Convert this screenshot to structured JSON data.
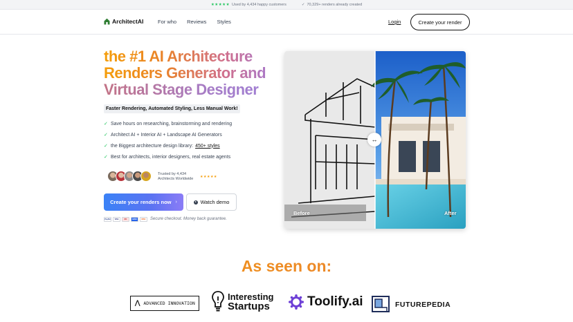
{
  "topbar": {
    "stars": "★★★★★",
    "customers": "Used by 4,434 happy customers",
    "check": "✓",
    "renders": "70,329+ renders already created"
  },
  "nav": {
    "brand": "ArchitectAI",
    "links": [
      "For who",
      "Reviews",
      "Styles"
    ],
    "login": "Login",
    "cta": "Create your render"
  },
  "hero": {
    "title_lines": [
      "the #1 AI Architecture",
      "Renders Generator and",
      "Virtual Stage Designer"
    ],
    "subtitle": "Faster Rendering, Automated Styling, Less Manual Work!",
    "benefits": [
      "Save hours on researching, brainstorming and rendering",
      "Architect AI + Interior AI + Landscape AI Generators",
      "the Biggest architecture design library:",
      "Best for architects, interior designers, real estate agents"
    ],
    "library_link": "450+ styles",
    "trusted_line1": "Trusted by 4,434",
    "trusted_line2": "Architects Worldwide",
    "trusted_stars": "★★★★★",
    "primary_cta": "Create your renders now",
    "primary_chevron": "›",
    "secondary_cta": "Watch demo",
    "payment_icons": [
      "PayPal",
      "VISA",
      "MC",
      "AMEX",
      "DISC"
    ],
    "secure": "Secure checkout. Money back guarantee."
  },
  "compare": {
    "before_label": "Before",
    "after_label": "After",
    "handle": "↔"
  },
  "press": {
    "heading": "As seen on:",
    "advanced_innovation": "ADVANCED INNOVATION",
    "interesting_1": "Interesting",
    "interesting_2": "Startups",
    "toolify": "Toolify.ai",
    "futurepedia": "FUTUREPEDIA"
  },
  "colors": {
    "accent_blue": "#3b82f6",
    "check_green": "#22c55e",
    "gradient_orange": "#f59e0b",
    "gradient_purple": "#a37bd4"
  }
}
